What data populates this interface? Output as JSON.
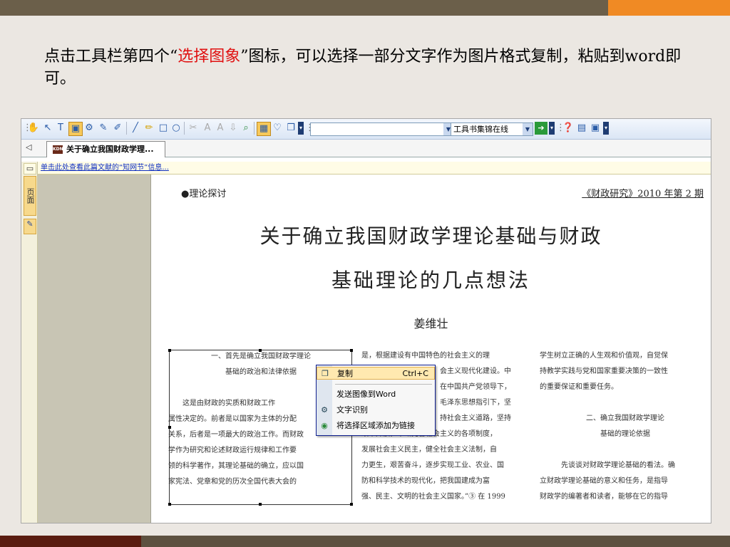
{
  "slide": {
    "instruction_pre": "点击工具栏第四个“",
    "instruction_highlight": "选择图象",
    "instruction_post": "”图标，可以选择一部分文字作为图片格式复制，粘贴到word即可。",
    "highlight_color": "#e01010",
    "accent_color": "#f08a24"
  },
  "toolbar": {
    "search_combo_value": "工具书集锦在线"
  },
  "tab": {
    "title": "关于确立我国财政学理...",
    "badge": "KDN"
  },
  "left_rail": {
    "tab_label": "页面"
  },
  "infobar": {
    "link_text": "单击此处查看此篇文献的“知网节”信息..."
  },
  "document": {
    "section_label": "●理论探讨",
    "journal": "《财政研究》2010 年第 2 期",
    "title_line1": "关于确立我国财政学理论基础与财政",
    "title_line2": "基础理论的几点想法",
    "author": "姜维壮",
    "col1": [
      "一、首先是确立我国财政学理论",
      "基础的政治和法律依据",
      "",
      "这是由财政的实质和财政工作",
      "属性决定的。前者是以国家为主体的分配",
      "关系，后者是一项最大的政治工作。而财政",
      "学作为研究和论述财政运行规律和工作要",
      "领的科学著作，其理论基础的确立，应以国",
      "家宪法、党章和党的历次全国代表大会的"
    ],
    "col2": [
      "是，根据建设有中国特色的社会主义的理",
      "会主义现代化建设。中",
      "在中国共产党领导下，",
      "毛泽东思想指引下，坚",
      "持社会主义道路，坚持",
      "改革开放，不断完善社会主义的各项制度，",
      "发展社会主义民主，健全社会主义法制，自",
      "力更生，艰苦奋斗，逐步实现工业、农业、国",
      "防和科学技术的现代化，把我国建成为富",
      "强、民主、文明的社会主义国家。”③ 在 1999"
    ],
    "col3": [
      "学生树立正确的人生观和价值观，自觉保",
      "持教学实践与党和国家重要决策的一致性",
      "的重要保证和重要任务。",
      "",
      "二、确立我国财政学理论",
      "基础的理论依据",
      "",
      "先谈谈对财政学理论基础的看法。确",
      "立财政学理论基础的意义和任务，是指导",
      "财政学的编著者和读者，能够在它的指导"
    ]
  },
  "context_menu": {
    "copy": "复制",
    "copy_shortcut": "Ctrl+C",
    "send_to_word": "发送图像到Word",
    "ocr": "文字识别",
    "add_link": "将选择区域添加为链接"
  }
}
